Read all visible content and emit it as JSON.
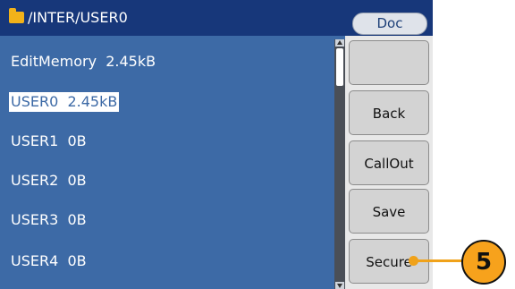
{
  "header": {
    "folder_icon": "folder-icon",
    "path": "/INTER/USER0",
    "tab_label": "Doc"
  },
  "files": [
    {
      "label": "EditMemory  2.45kB",
      "selected": false
    },
    {
      "label": "USER0  2.45kB",
      "selected": true
    },
    {
      "label": "USER1  0B",
      "selected": false
    },
    {
      "label": "USER2  0B",
      "selected": false
    },
    {
      "label": "USER3  0B",
      "selected": false
    },
    {
      "label": "USER4  0B",
      "selected": false
    }
  ],
  "softkeys": [
    "",
    "Back",
    "CallOut",
    "Save",
    "Secure"
  ],
  "callout": {
    "number": "5",
    "color": "#f7a21c"
  },
  "colors": {
    "screen_bg": "#3d6aa6",
    "title_bg": "#17377a",
    "button_bg": "#d3d3d3"
  }
}
